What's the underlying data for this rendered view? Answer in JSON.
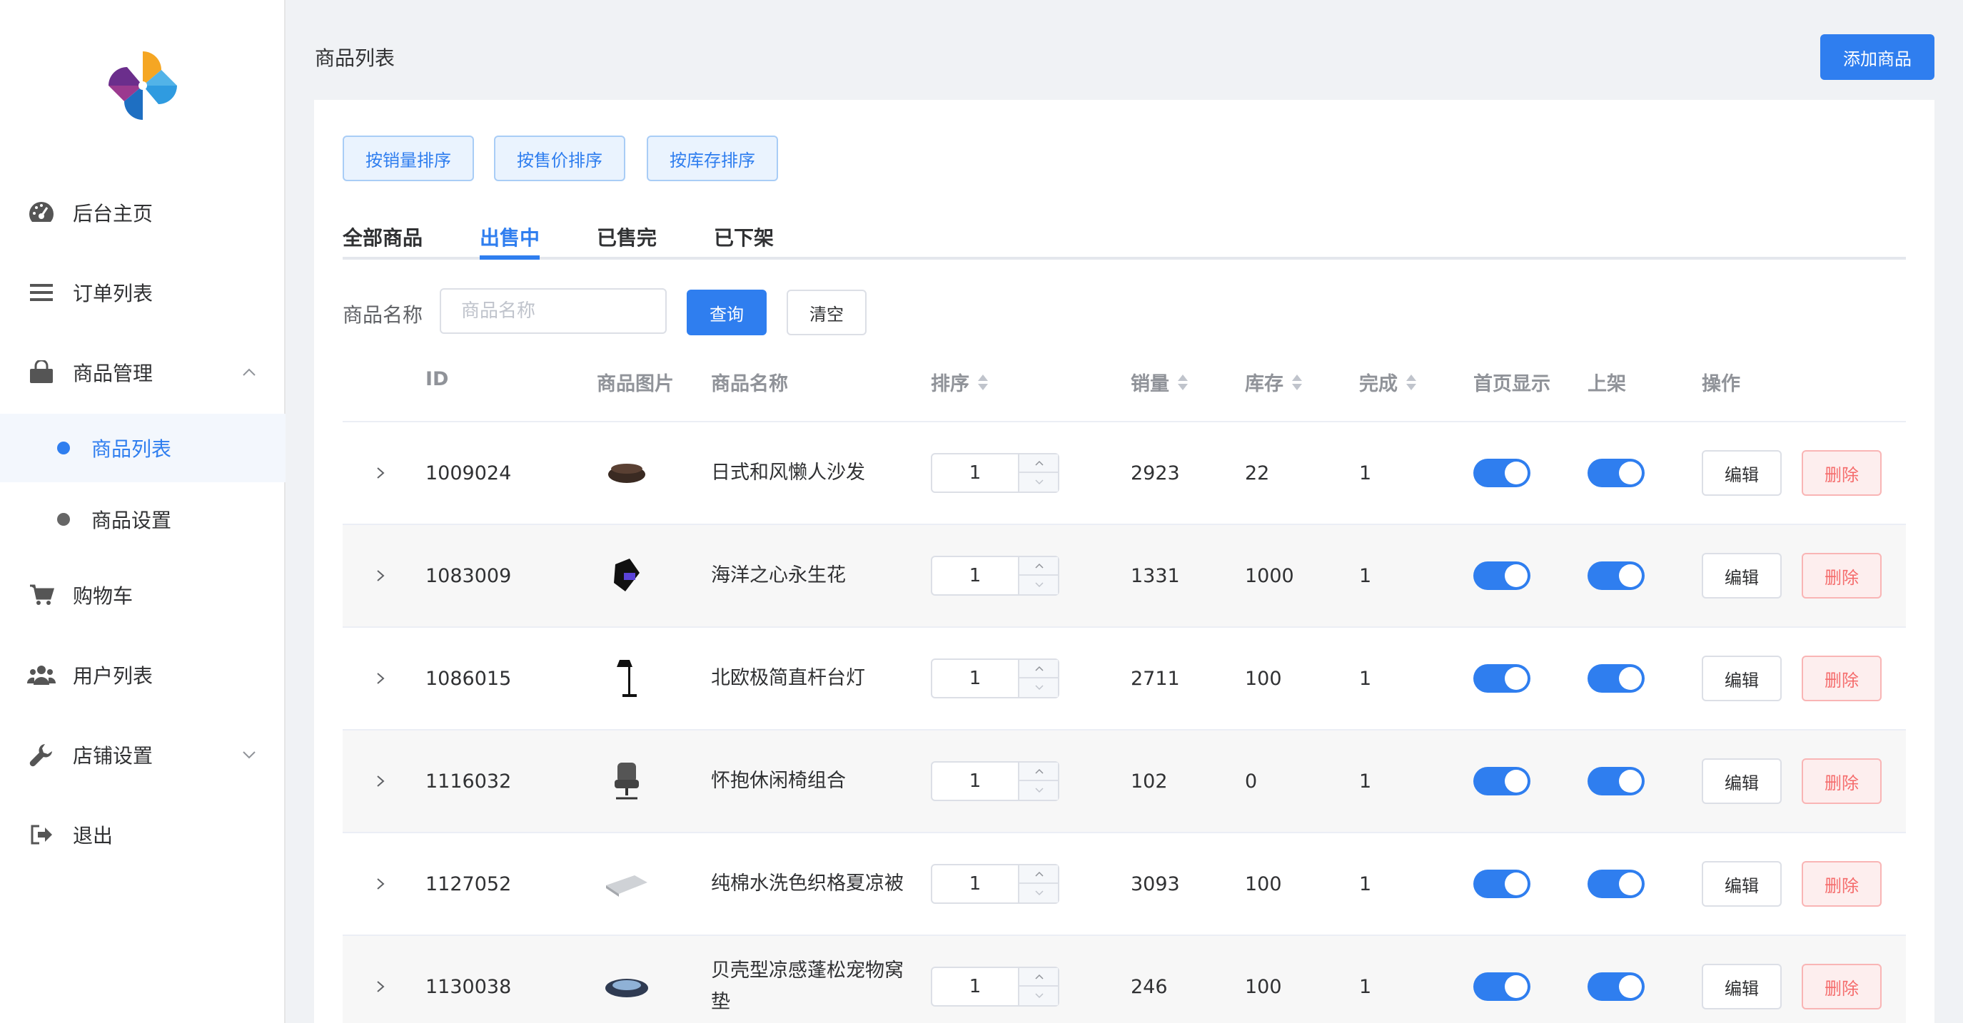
{
  "sidebar": {
    "items": [
      {
        "label": "后台主页",
        "icon": "dashboard-icon"
      },
      {
        "label": "订单列表",
        "icon": "list-icon"
      },
      {
        "label": "商品管理",
        "icon": "shopping-bag-icon"
      },
      {
        "label": "购物车",
        "icon": "cart-icon"
      },
      {
        "label": "用户列表",
        "icon": "users-icon"
      },
      {
        "label": "店铺设置",
        "icon": "wrench-icon"
      },
      {
        "label": "退出",
        "icon": "logout-icon"
      }
    ],
    "sub_items": [
      {
        "label": "商品列表",
        "active": true
      },
      {
        "label": "商品设置",
        "active": false
      }
    ]
  },
  "header": {
    "title": "商品列表",
    "add_button": "添加商品"
  },
  "sort_buttons": [
    "按销量排序",
    "按售价排序",
    "按库存排序"
  ],
  "tabs": [
    "全部商品",
    "出售中",
    "已售完",
    "已下架"
  ],
  "active_tab": 1,
  "filter": {
    "label": "商品名称",
    "placeholder": "商品名称",
    "value": "",
    "query_label": "查询",
    "clear_label": "清空"
  },
  "table": {
    "columns": [
      "ID",
      "商品图片",
      "商品名称",
      "排序",
      "销量",
      "库存",
      "完成",
      "首页显示",
      "上架",
      "操作"
    ],
    "edit_label": "编辑",
    "delete_label": "删除",
    "rows": [
      {
        "id": "1009024",
        "name": "日式和风懒人沙发",
        "order": "1",
        "sales": "2923",
        "stock": "22",
        "done": "1",
        "home": true,
        "listed": true
      },
      {
        "id": "1083009",
        "name": "海洋之心永生花",
        "order": "1",
        "sales": "1331",
        "stock": "1000",
        "done": "1",
        "home": true,
        "listed": true
      },
      {
        "id": "1086015",
        "name": "北欧极简直杆台灯",
        "order": "1",
        "sales": "2711",
        "stock": "100",
        "done": "1",
        "home": true,
        "listed": true
      },
      {
        "id": "1116032",
        "name": "怀抱休闲椅组合",
        "order": "1",
        "sales": "102",
        "stock": "0",
        "done": "1",
        "home": true,
        "listed": true
      },
      {
        "id": "1127052",
        "name": "纯棉水洗色织格夏凉被",
        "order": "1",
        "sales": "3093",
        "stock": "100",
        "done": "1",
        "home": true,
        "listed": true
      },
      {
        "id": "1130038",
        "name": "贝壳型凉感蓬松宠物窝垫",
        "order": "1",
        "sales": "246",
        "stock": "100",
        "done": "1",
        "home": true,
        "listed": true
      }
    ]
  },
  "colors": {
    "primary": "#2f7eef",
    "danger": "#f56c6c"
  }
}
